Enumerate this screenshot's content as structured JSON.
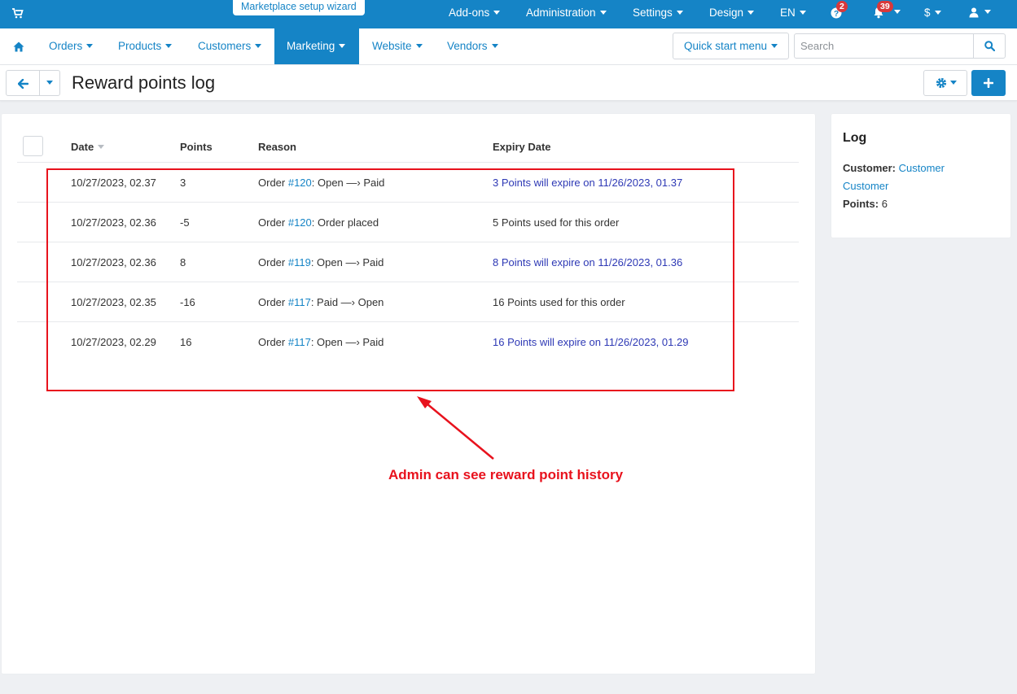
{
  "topbar": {
    "wizard_label": "Marketplace setup wizard",
    "menu": {
      "addons": "Add-ons",
      "administration": "Administration",
      "settings": "Settings",
      "design": "Design",
      "language": "EN",
      "currency": "$"
    },
    "help_badge": "2",
    "notifications_badge": "39"
  },
  "mainnav": {
    "items": [
      "Orders",
      "Products",
      "Customers",
      "Marketing",
      "Website",
      "Vendors"
    ],
    "active": "Marketing",
    "quick_start": "Quick start menu",
    "search_placeholder": "Search"
  },
  "page": {
    "title": "Reward points log"
  },
  "table": {
    "headers": {
      "date": "Date",
      "points": "Points",
      "reason": "Reason",
      "expiry": "Expiry Date"
    },
    "rows": [
      {
        "date": "10/27/2023, 02.37",
        "points": "3",
        "reason_prefix": "Order ",
        "order_link": "#120",
        "reason_suffix": ": Open —› Paid",
        "expiry": "3 Points will expire on 11/26/2023, 01.37",
        "expiry_is_link": true
      },
      {
        "date": "10/27/2023, 02.36",
        "points": "-5",
        "reason_prefix": "Order ",
        "order_link": "#120",
        "reason_suffix": ": Order placed",
        "expiry": "5 Points used for this order",
        "expiry_is_link": false
      },
      {
        "date": "10/27/2023, 02.36",
        "points": "8",
        "reason_prefix": "Order ",
        "order_link": "#119",
        "reason_suffix": ": Open —› Paid",
        "expiry": "8 Points will expire on 11/26/2023, 01.36",
        "expiry_is_link": true
      },
      {
        "date": "10/27/2023, 02.35",
        "points": "-16",
        "reason_prefix": "Order ",
        "order_link": "#117",
        "reason_suffix": ": Paid —› Open",
        "expiry": "16 Points used for this order",
        "expiry_is_link": false
      },
      {
        "date": "10/27/2023, 02.29",
        "points": "16",
        "reason_prefix": "Order ",
        "order_link": "#117",
        "reason_suffix": ": Open —› Paid",
        "expiry": "16 Points will expire on 11/26/2023, 01.29",
        "expiry_is_link": true
      }
    ]
  },
  "annotation": {
    "text": "Admin can see reward point history",
    "color": "#e8121d"
  },
  "sidebar": {
    "title": "Log",
    "customer_label": "Customer:",
    "customer_value_1": "Customer",
    "customer_value_2": "Customer",
    "points_label": "Points:",
    "points_value": "6"
  },
  "colors": {
    "brand": "#1584c6",
    "expiry_link": "#2e39b5",
    "badge": "#d8383b"
  }
}
